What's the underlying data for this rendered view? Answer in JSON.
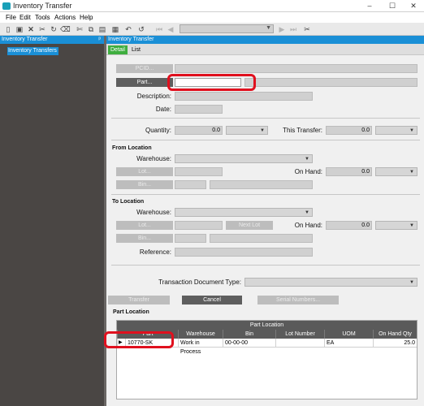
{
  "window": {
    "title": "Inventory Transfer",
    "controls": [
      "–",
      "☐",
      "✕"
    ]
  },
  "menu": [
    "File",
    "Edit",
    "Tools",
    "Actions",
    "Help"
  ],
  "toolbar": {
    "icons": [
      "new-icon",
      "save-icon",
      "delete-icon",
      "cut-icon",
      "refresh-icon",
      "clear-icon",
      "copy-icon",
      "paste-icon",
      "attach-icon",
      "undo-icon",
      "first-icon",
      "prev-icon",
      "next-icon",
      "last-icon",
      "cut-tool-icon"
    ]
  },
  "tree": {
    "header": "Inventory Transfer",
    "pin": "ᵖ",
    "item": "Inventory Transfers"
  },
  "main": {
    "header": "Inventory Transfer",
    "tabs": [
      "Detail",
      "List"
    ]
  },
  "form": {
    "pcid_button": "PCID...",
    "part_button": "Part...",
    "part_value": "",
    "description_label": "Description:",
    "date_label": "Date:",
    "quantity_label": "Quantity:",
    "quantity_value": "0.0",
    "this_transfer_label": "This Transfer:",
    "this_transfer_value": "0.0",
    "from_section": "From Location",
    "from_warehouse_label": "Warehouse:",
    "from_lot_button": "Lot...",
    "from_on_hand_label": "On Hand:",
    "from_on_hand_value": "0.0",
    "from_bin_button": "Bin...",
    "to_section": "To Location",
    "to_warehouse_label": "Warehouse:",
    "to_lot_button": "Lot...",
    "next_lot_button": "Next Lot",
    "to_on_hand_label": "On Hand:",
    "to_on_hand_value": "0.0",
    "to_bin_button": "Bin...",
    "reference_label": "Reference:",
    "tdt_label": "Transaction Document Type:",
    "transfer_button": "Transfer",
    "cancel_button": "Cancel",
    "serial_button": "Serial Numbers...",
    "part_location_section": "Part Location"
  },
  "grid": {
    "band": "Part Location",
    "columns": [
      "Part",
      "Warehouse",
      "Bin",
      "Lot Number",
      "UOM",
      "On Hand Qty"
    ],
    "rows": [
      [
        "10770-SK",
        "Work in Process",
        "00-00-00",
        "",
        "EA",
        "25.0"
      ]
    ]
  }
}
